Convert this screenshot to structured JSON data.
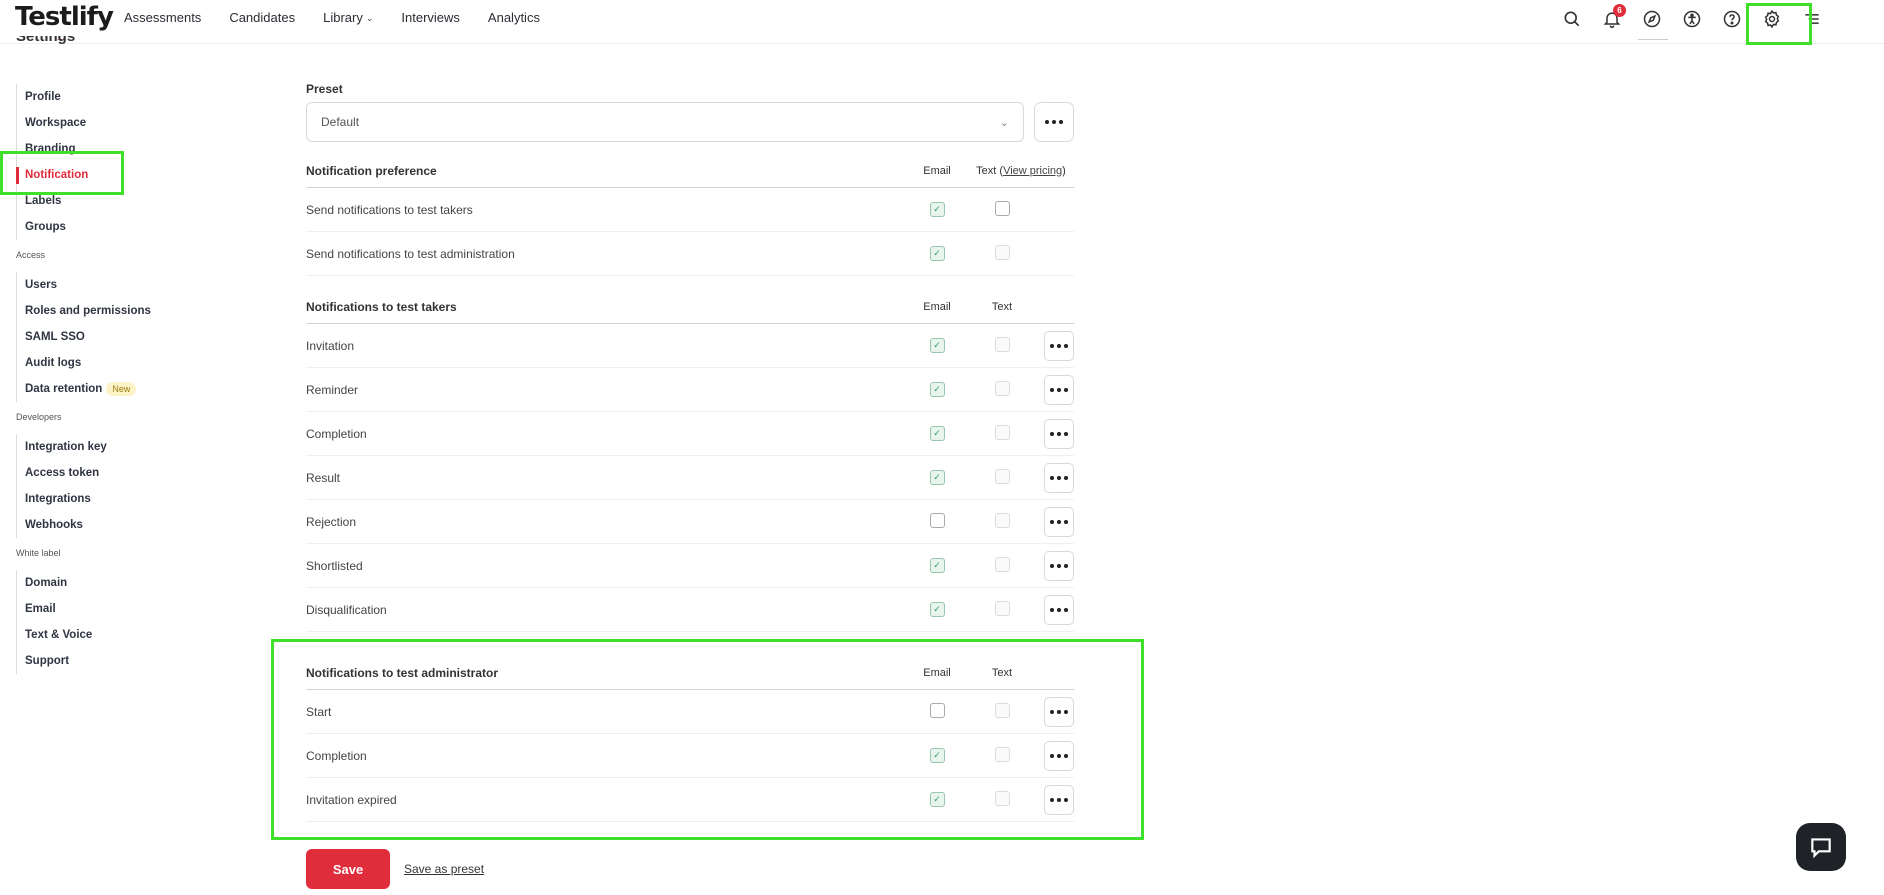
{
  "brand": {
    "logo": "Testlify",
    "logo_dots": "....",
    "accent": "#e02d3c",
    "highlight": "#3ee02c"
  },
  "nav": {
    "items": [
      "Assessments",
      "Candidates",
      "Library",
      "Interviews",
      "Analytics"
    ],
    "notification_count": "6",
    "icons": [
      "search-icon",
      "bell-icon",
      "compass-icon",
      "accessibility-icon",
      "help-icon",
      "gear-icon",
      "menu-icon"
    ]
  },
  "page": {
    "heading": "Settings"
  },
  "sidebar": {
    "general": [
      "Profile",
      "Workspace",
      "Branding",
      "Notification",
      "Labels",
      "Groups"
    ],
    "access_title": "Access",
    "access": [
      "Users",
      "Roles and permissions",
      "SAML SSO",
      "Audit logs",
      "Data retention"
    ],
    "new_tag": "New",
    "developers_title": "Developers",
    "developers": [
      "Integration key",
      "Access token",
      "Integrations",
      "Webhooks"
    ],
    "whitelabel_title": "White label",
    "whitelabel": [
      "Domain",
      "Email",
      "Text & Voice",
      "Support"
    ],
    "active": "Notification"
  },
  "preset": {
    "label": "Preset",
    "value": "Default"
  },
  "preference": {
    "title": "Notification preference",
    "email_col": "Email",
    "text_col_prefix": "Text (",
    "text_col_link": "View pricing",
    "text_col_suffix": ")",
    "rows": [
      {
        "label": "Send notifications to test takers",
        "email": true,
        "text": false,
        "text_disabled": false
      },
      {
        "label": "Send notifications to test administration",
        "email": true,
        "text": false,
        "text_disabled": true
      }
    ]
  },
  "takers": {
    "title": "Notifications to test takers",
    "email_col": "Email",
    "text_col": "Text",
    "rows": [
      {
        "label": "Invitation",
        "email": true
      },
      {
        "label": "Reminder",
        "email": true
      },
      {
        "label": "Completion",
        "email": true
      },
      {
        "label": "Result",
        "email": true
      },
      {
        "label": "Rejection",
        "email": false
      },
      {
        "label": "Shortlisted",
        "email": true
      },
      {
        "label": "Disqualification",
        "email": true
      }
    ]
  },
  "admin": {
    "title": "Notifications to test administrator",
    "email_col": "Email",
    "text_col": "Text",
    "rows": [
      {
        "label": "Start",
        "email": false
      },
      {
        "label": "Completion",
        "email": true
      },
      {
        "label": "Invitation expired",
        "email": true
      }
    ]
  },
  "actions": {
    "save": "Save",
    "save_preset": "Save as preset"
  }
}
